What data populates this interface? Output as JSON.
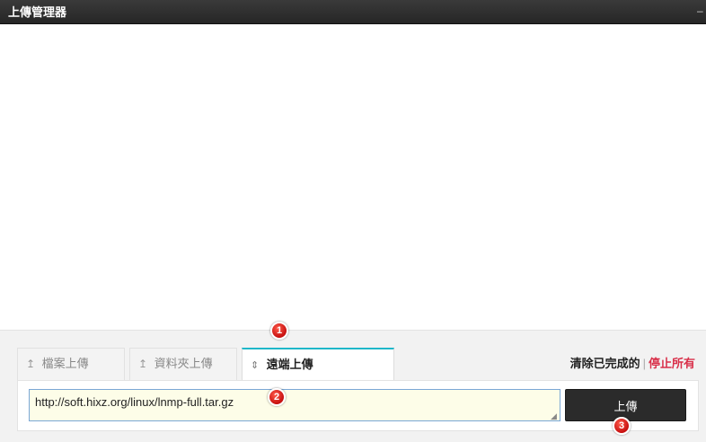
{
  "window": {
    "title": "上傳管理器",
    "minimize_label": "–"
  },
  "tabs": [
    {
      "label": "檔案上傳",
      "icon": "upload-arrow-icon",
      "icon_glyph": "↥"
    },
    {
      "label": "資料夾上傳",
      "icon": "upload-arrow-icon",
      "icon_glyph": "↥"
    },
    {
      "label": "遠端上傳",
      "icon": "updown-arrow-icon",
      "icon_glyph": "⇕",
      "active": true
    }
  ],
  "actions": {
    "clear_completed": "清除已完成的",
    "separator": "|",
    "stop_all": "停止所有"
  },
  "remote": {
    "url_value": "http://soft.hixz.org/linux/lnmp-full.tar.gz",
    "upload_button": "上傳"
  },
  "markers": [
    "1",
    "2",
    "3"
  ],
  "colors": {
    "titlebar": "#262626",
    "active_tab_accent": "#1fb7c9",
    "stop_all": "#d9304a",
    "input_background": "#fdfde8",
    "upload_button": "#2b2b2b",
    "marker": "#c60f0f"
  }
}
